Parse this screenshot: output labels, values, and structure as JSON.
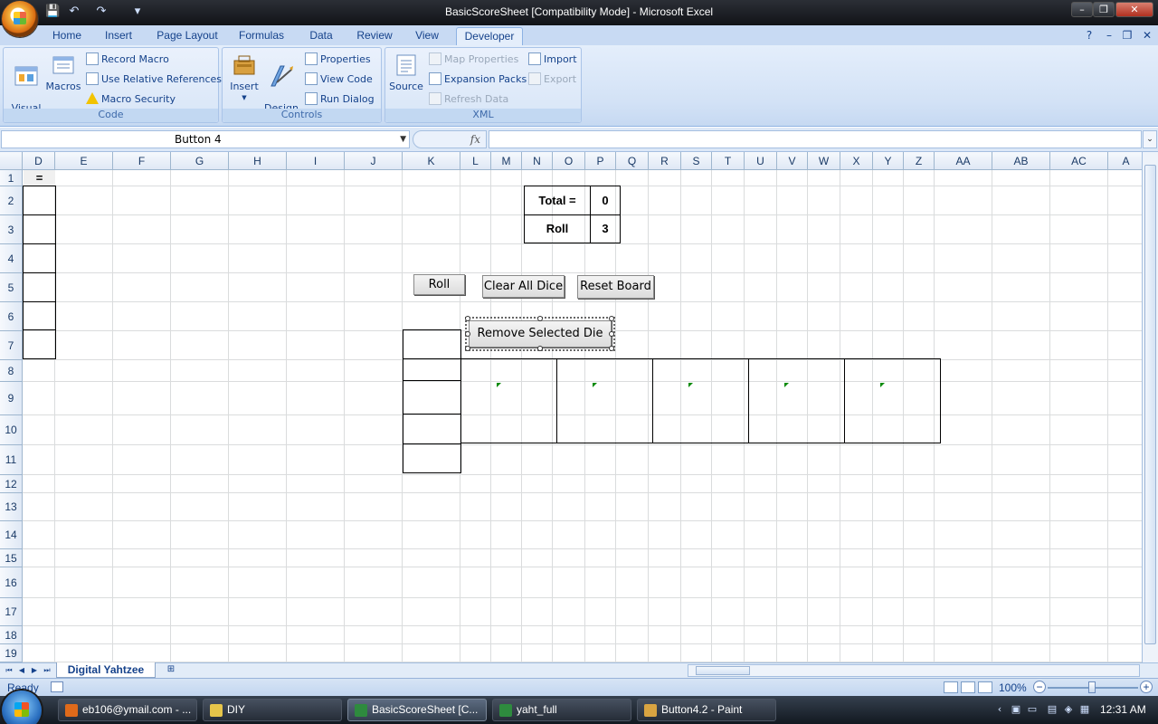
{
  "window": {
    "title": "BasicScoreSheet  [Compatibility Mode] - Microsoft Excel",
    "minimize": "–",
    "restore": "❐",
    "close": "✕"
  },
  "quick_access": {
    "save": "💾",
    "undo": "↶",
    "redo": "↷",
    "customize": "▾"
  },
  "ribbon_tabs": [
    "Home",
    "Insert",
    "Page Layout",
    "Formulas",
    "Data",
    "Review",
    "View",
    "Developer"
  ],
  "active_tab": "Developer",
  "help": "?",
  "ribbon": {
    "code": {
      "label": "Code",
      "visual_basic": "Visual\nBasic",
      "macros": "Macros",
      "record_macro": "Record Macro",
      "relative_refs": "Use Relative References",
      "macro_security": "Macro Security"
    },
    "controls": {
      "label": "Controls",
      "insert": "Insert",
      "design_mode": "Design\nMode",
      "properties": "Properties",
      "view_code": "View Code",
      "run_dialog": "Run Dialog"
    },
    "xml": {
      "label": "XML",
      "source": "Source",
      "map_properties": "Map Properties",
      "expansion_packs": "Expansion Packs",
      "refresh_data": "Refresh Data",
      "import": "Import",
      "export": "Export"
    }
  },
  "formula_bar": {
    "name_box": "Button 4",
    "fx": "fx",
    "formula": ""
  },
  "columns": [
    "D",
    "E",
    "F",
    "G",
    "H",
    "I",
    "J",
    "K",
    "L",
    "M",
    "N",
    "O",
    "P",
    "Q",
    "R",
    "S",
    "T",
    "U",
    "V",
    "W",
    "X",
    "Y",
    "Z",
    "AA",
    "AB",
    "AC",
    "A"
  ],
  "rows": [
    "1",
    "2",
    "3",
    "4",
    "5",
    "6",
    "7",
    "8",
    "9",
    "10",
    "11",
    "12",
    "13",
    "14",
    "15",
    "16",
    "17",
    "18",
    "19"
  ],
  "cells": {
    "d1": "=",
    "total_label": "Total =",
    "total_value": "0",
    "roll_label": "Roll",
    "roll_value": "3"
  },
  "buttons": {
    "roll": "Roll",
    "clear_all_dice": "Clear All Dice",
    "reset_board": "Reset Board",
    "remove_selected_die": "Remove Selected Die"
  },
  "sheet_tabs": {
    "active": "Digital Yahtzee"
  },
  "status": {
    "ready": "Ready",
    "zoom": "100%"
  },
  "taskbar": {
    "items": [
      {
        "label": "eb106@ymail.com - ...",
        "color": "#e06a1a"
      },
      {
        "label": "DIY",
        "color": "#e6c54a"
      },
      {
        "label": "BasicScoreSheet  [C...",
        "color": "#2e8b3e"
      },
      {
        "label": "yaht_full",
        "color": "#2e8b3e"
      },
      {
        "label": "Button4.2 - Paint",
        "color": "#d9a441"
      }
    ],
    "clock": "12:31 AM"
  }
}
